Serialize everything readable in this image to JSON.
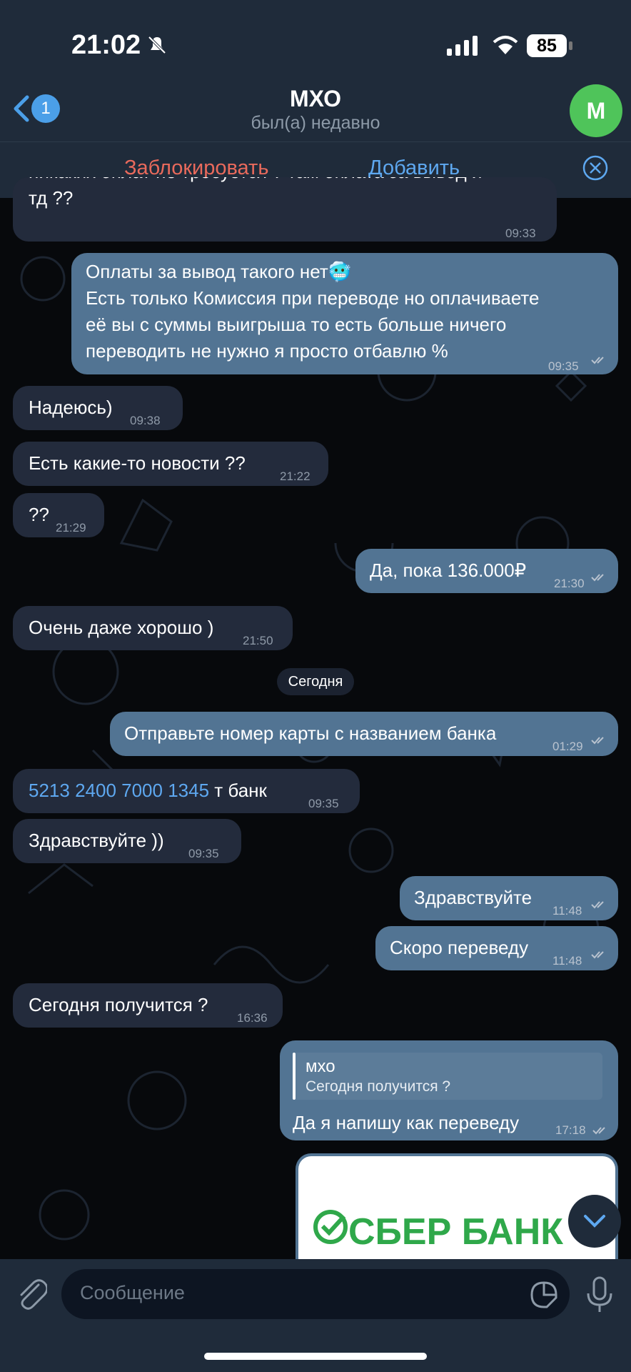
{
  "status_bar": {
    "time": "21:02",
    "battery": "85"
  },
  "header": {
    "back_badge": "1",
    "title": "МХО",
    "subtitle": "был(а) недавно",
    "avatar_letter": "M"
  },
  "action_bar": {
    "block_label": "Заблокировать",
    "add_label": "Добавить"
  },
  "messages": [
    {
      "dir": "in",
      "lines": [
        "никаких оплат не требуется ? там оплата за вывод и",
        "тд ??"
      ],
      "time": "09:33"
    },
    {
      "dir": "out",
      "lines": [
        "Оплаты за вывод такого нет🥶",
        "Есть только Комиссия при переводе но оплачиваете",
        "её вы с суммы выигрыша то есть больше ничего",
        "переводить не нужно я просто отбавлю %"
      ],
      "time": "09:35"
    },
    {
      "dir": "in",
      "text": "Надеюсь)",
      "time": "09:38"
    },
    {
      "dir": "in",
      "text": "Есть какие-то новости ??",
      "time": "21:22"
    },
    {
      "dir": "in",
      "text": "??",
      "time": "21:29"
    },
    {
      "dir": "out",
      "text": "Да, пока 136.000₽",
      "time": "21:30"
    },
    {
      "dir": "in",
      "text": "Очень даже хорошо )",
      "time": "21:50"
    },
    {
      "dir": "out",
      "text": "Отправьте номер карты с названием банка",
      "time": "01:29"
    },
    {
      "dir": "in",
      "card": "5213 2400 7000 1345",
      "text": "т банк",
      "time": "09:35"
    },
    {
      "dir": "in",
      "text": "Здравствуйте ))",
      "time": "09:35"
    },
    {
      "dir": "out",
      "text": "Здравствуйте",
      "time": "11:48"
    },
    {
      "dir": "out",
      "text": "Скоро переведу",
      "time": "11:48"
    },
    {
      "dir": "in",
      "text": "Сегодня получится ?",
      "time": "16:36"
    },
    {
      "dir": "out",
      "reply_name": "мхо",
      "reply_text": "Сегодня получится ?",
      "text": "Да я напишу как переведу",
      "time": "17:18"
    }
  ],
  "date_separator": "Сегодня",
  "image_preview": {
    "brand_text": "СБЕР БАНК"
  },
  "input": {
    "placeholder": "Сообщение"
  },
  "colors": {
    "bar": "#1f2b3a",
    "incoming": "#232b3c",
    "outgoing": "#527493",
    "accent": "#5ea8f0",
    "danger": "#e96a5c"
  }
}
